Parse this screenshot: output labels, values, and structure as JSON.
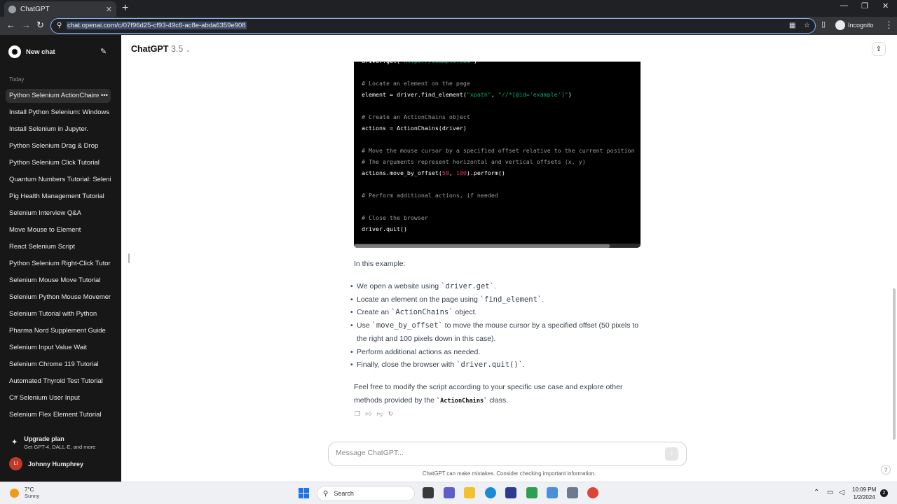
{
  "browser": {
    "tab_title": "ChatGPT",
    "url": "chat.openai.com/c/07f96d25-cf93-49c6-ac8e-abda6359e908",
    "incognito_label": "Incognito"
  },
  "sidebar": {
    "new_chat_label": "New chat",
    "section_label": "Today",
    "history": [
      "Python Selenium ActionChains",
      "Install Python Selenium: Windows",
      "Install Selenium in Jupyter.",
      "Python Selenium Drag & Drop",
      "Python Selenium Click Tutorial",
      "Quantum Numbers Tutorial: Selenium",
      "Pig Health Management Tutorial",
      "Selenium Interview Q&A",
      "Move Mouse to Element",
      "React Selenium Script",
      "Python Selenium Right-Click Tutorial",
      "Selenium Mouse Move Tutorial",
      "Selenium Python Mouse Movement",
      "Selenium Tutorial with Python",
      "Pharma Nord Supplement Guide",
      "Selenium Input Value Wait",
      "Selenium Chrome 119 Tutorial",
      "Automated Thyroid Test Tutorial",
      "C# Selenium User Input",
      "Selenium Flex Element Tutorial"
    ],
    "upgrade_title": "Upgrade plan",
    "upgrade_subtitle": "Get GPT-4, DALL·E, and more",
    "user_initials": "LI",
    "user_name": "Johnny Humphrey"
  },
  "header": {
    "model_name": "ChatGPT",
    "model_version": "3.5"
  },
  "code_lines": [
    {
      "segments": [
        {
          "t": "driver.get(",
          "c": ""
        },
        {
          "t": "\"https://example.com\"",
          "c": "str"
        },
        {
          "t": ")",
          "c": ""
        }
      ]
    },
    {
      "segments": []
    },
    {
      "segments": [
        {
          "t": "# Locate an element on the page",
          "c": "cmt"
        }
      ]
    },
    {
      "segments": [
        {
          "t": "element = driver.find_element(",
          "c": ""
        },
        {
          "t": "\"xpath\"",
          "c": "str"
        },
        {
          "t": ", ",
          "c": ""
        },
        {
          "t": "\"//*[@id='example']\"",
          "c": "str"
        },
        {
          "t": ")",
          "c": ""
        }
      ]
    },
    {
      "segments": []
    },
    {
      "segments": [
        {
          "t": "# Create an ActionChains object",
          "c": "cmt"
        }
      ]
    },
    {
      "segments": [
        {
          "t": "actions = ActionChains(driver)",
          "c": ""
        }
      ]
    },
    {
      "segments": []
    },
    {
      "segments": [
        {
          "t": "# Move the mouse cursor by a specified offset relative to the current position",
          "c": "cmt"
        }
      ]
    },
    {
      "segments": [
        {
          "t": "# The arguments represent horizontal and vertical offsets (x, y)",
          "c": "cmt"
        }
      ]
    },
    {
      "segments": [
        {
          "t": "actions.move_by_offset(",
          "c": ""
        },
        {
          "t": "50",
          "c": "num"
        },
        {
          "t": ", ",
          "c": ""
        },
        {
          "t": "100",
          "c": "num"
        },
        {
          "t": ").perform()",
          "c": ""
        }
      ]
    },
    {
      "segments": []
    },
    {
      "segments": [
        {
          "t": "# Perform additional actions, if needed",
          "c": "cmt"
        }
      ]
    },
    {
      "segments": []
    },
    {
      "segments": [
        {
          "t": "# Close the browser",
          "c": "cmt"
        }
      ]
    },
    {
      "segments": [
        {
          "t": "driver.quit()",
          "c": ""
        }
      ]
    }
  ],
  "response": {
    "intro": "In this example:",
    "bullets": [
      [
        {
          "t": "We open a website using "
        },
        {
          "t": "`driver.get`",
          "code": true
        },
        {
          "t": "."
        }
      ],
      [
        {
          "t": "Locate an element on the page using "
        },
        {
          "t": "`find_element`",
          "code": true
        },
        {
          "t": "."
        }
      ],
      [
        {
          "t": "Create an "
        },
        {
          "t": "`ActionChains`",
          "code": true
        },
        {
          "t": " object."
        }
      ],
      [
        {
          "t": "Use "
        },
        {
          "t": "`move_by_offset`",
          "code": true
        },
        {
          "t": " to move the mouse cursor by a specified offset (50 pixels to the right and 100 pixels down in this case)."
        }
      ],
      [
        {
          "t": "Perform additional actions as needed."
        }
      ],
      [
        {
          "t": "Finally, close the browser with "
        },
        {
          "t": "`driver.quit()`",
          "code": true
        },
        {
          "t": "."
        }
      ]
    ],
    "outro_before": "Feel free to modify the script according to your specific use case and explore other methods provided by the ",
    "outro_code": "`ActionChains`",
    "outro_after": " class."
  },
  "composer": {
    "placeholder": "Message ChatGPT..."
  },
  "disclaimer": "ChatGPT can make mistakes. Consider checking important information.",
  "taskbar": {
    "temperature": "7°C",
    "condition": "Sunny",
    "search_label": "Search",
    "time": "10:09 PM",
    "date": "1/2/2024",
    "notifications": "2"
  }
}
